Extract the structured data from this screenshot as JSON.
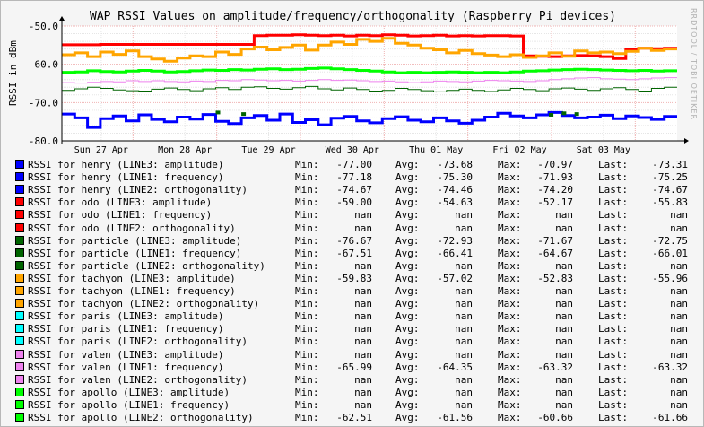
{
  "chart_data": {
    "type": "line",
    "title": "WAP RSSI Values on amplitude/frequency/orthogonality (Raspberry Pi devices)",
    "ylabel": "RSSI in dBm",
    "ylim": [
      -80,
      -50
    ],
    "yticks": [
      "-50.0",
      "-60.0",
      "-70.0",
      "-80.0"
    ],
    "ytick_values": [
      -50,
      -60,
      -70,
      -80
    ],
    "xticks": [
      "Sun 27 Apr",
      "Mon 28 Apr",
      "Tue 29 Apr",
      "Wed 30 Apr",
      "Thu 01 May",
      "Fri 02 May",
      "Sat 03 May"
    ],
    "grid": true,
    "watermark": "RRDTOOL / TOBI OETIKER",
    "plotted_series": [
      {
        "name": "RSSI for henry (LINE3: amplitude)",
        "color": "#0000ff",
        "width": 3,
        "values": [
          -73.0,
          -74.0,
          -76.5,
          -74.2,
          -73.5,
          -74.8,
          -73.2,
          -74.4,
          -75.0,
          -73.8,
          -74.3,
          -73.1,
          -74.9,
          -75.5,
          -74.0,
          -73.4,
          -74.6,
          -73.0,
          -75.2,
          -74.5,
          -75.8,
          -74.1,
          -73.6,
          -74.8,
          -75.3,
          -74.2,
          -73.7,
          -74.6,
          -75.0,
          -74.0,
          -74.8,
          -75.4,
          -74.6,
          -73.8,
          -72.8,
          -73.5,
          -74.0,
          -73.2,
          -72.6,
          -73.4,
          -74.0,
          -73.8,
          -73.3,
          -74.2,
          -73.5,
          -73.9,
          -74.4,
          -73.6
        ]
      },
      {
        "name": "RSSI for odo (LINE3: amplitude)",
        "color": "#ff0000",
        "width": 3,
        "values": [
          -54.9,
          -54.9,
          -54.9,
          -54.8,
          -54.8,
          -54.8,
          -54.8,
          -54.8,
          -54.8,
          -54.8,
          -54.8,
          -54.8,
          -54.8,
          -54.8,
          -54.8,
          -52.5,
          -52.4,
          -52.4,
          -52.3,
          -52.4,
          -52.5,
          -52.4,
          -52.6,
          -52.4,
          -52.5,
          -52.3,
          -52.4,
          -52.6,
          -52.5,
          -52.4,
          -52.6,
          -52.5,
          -52.6,
          -52.5,
          -52.5,
          -52.6,
          -57.8,
          -57.9,
          -58.0,
          -57.8,
          -57.7,
          -57.8,
          -58.0,
          -58.5,
          -56.0,
          -55.8,
          -55.9,
          -55.8
        ]
      },
      {
        "name": "RSSI for tachyon (LINE3: amplitude)",
        "color": "#ffa500",
        "width": 3,
        "values": [
          -57.5,
          -57.0,
          -58.0,
          -56.8,
          -57.4,
          -56.5,
          -58.0,
          -58.6,
          -59.2,
          -58.4,
          -57.8,
          -58.0,
          -56.8,
          -57.4,
          -56.0,
          -55.5,
          -56.2,
          -55.6,
          -55.0,
          -56.3,
          -55.0,
          -54.2,
          -54.8,
          -53.5,
          -54.0,
          -53.2,
          -54.5,
          -55.0,
          -55.8,
          -56.2,
          -57.0,
          -56.4,
          -57.2,
          -57.6,
          -58.0,
          -57.5,
          -58.2,
          -57.8,
          -57.0,
          -57.9,
          -56.5,
          -57.0,
          -56.8,
          -57.2,
          -56.6,
          -55.8,
          -56.4,
          -56.0
        ]
      },
      {
        "name": "RSSI for apollo (LINE2: orthogonality)",
        "color": "#00ff00",
        "width": 3,
        "values": [
          -62.1,
          -62.0,
          -61.7,
          -61.9,
          -62.0,
          -61.8,
          -61.6,
          -61.8,
          -62.0,
          -61.9,
          -61.7,
          -61.5,
          -61.6,
          -61.4,
          -61.5,
          -61.3,
          -61.2,
          -61.4,
          -61.3,
          -61.1,
          -61.0,
          -61.2,
          -61.4,
          -61.6,
          -61.8,
          -62.0,
          -62.2,
          -62.1,
          -62.2,
          -62.1,
          -62.0,
          -62.1,
          -62.2,
          -62.1,
          -62.2,
          -62.0,
          -61.8,
          -61.7,
          -61.5,
          -61.4,
          -61.3,
          -61.4,
          -61.5,
          -61.6,
          -61.7,
          -61.6,
          -61.8,
          -61.7
        ]
      },
      {
        "name": "RSSI for valen (LINE1: frequency)",
        "color": "#ee82ee",
        "width": 1,
        "values": [
          -64.8,
          -64.9,
          -64.7,
          -64.5,
          -64.6,
          -64.3,
          -64.5,
          -64.3,
          -64.5,
          -64.6,
          -64.4,
          -64.5,
          -64.2,
          -64.3,
          -64.0,
          -64.1,
          -64.3,
          -64.2,
          -64.4,
          -64.2,
          -64.0,
          -64.2,
          -64.1,
          -64.3,
          -64.5,
          -64.4,
          -64.6,
          -64.8,
          -64.6,
          -64.4,
          -64.5,
          -64.6,
          -64.4,
          -64.2,
          -64.3,
          -64.4,
          -64.5,
          -64.3,
          -64.0,
          -63.8,
          -63.6,
          -63.5,
          -63.8,
          -63.9,
          -64.0,
          -63.8,
          -63.6,
          -63.5
        ]
      },
      {
        "name": "RSSI for particle (LINE1: frequency)",
        "color": "#006400",
        "width": 1,
        "values": [
          -66.8,
          -66.4,
          -66.0,
          -66.3,
          -66.7,
          -66.9,
          -67.0,
          -66.5,
          -66.2,
          -66.6,
          -66.9,
          -66.4,
          -66.1,
          -66.6,
          -66.0,
          -65.9,
          -66.3,
          -66.5,
          -66.1,
          -65.8,
          -66.4,
          -66.7,
          -66.2,
          -66.6,
          -67.0,
          -66.8,
          -66.3,
          -66.6,
          -66.9,
          -67.2,
          -66.8,
          -66.5,
          -66.8,
          -67.1,
          -66.7,
          -66.3,
          -66.6,
          -66.9,
          -66.4,
          -66.2,
          -66.5,
          -66.8,
          -66.4,
          -66.1,
          -66.6,
          -67.0,
          -66.3,
          -66.0
        ]
      }
    ],
    "particle_amplitude_points": [
      {
        "i": 12,
        "y": -72.6
      },
      {
        "i": 14,
        "y": -73.0
      },
      {
        "i": 38,
        "y": -73.2
      },
      {
        "i": 39,
        "y": -72.8
      },
      {
        "i": 40,
        "y": -73.0
      }
    ]
  },
  "legend": {
    "min_label": "Min:",
    "avg_label": "Avg:",
    "max_label": "Max:",
    "last_label": "Last:",
    "rows": [
      {
        "color": "#0000ff",
        "name": "RSSI for henry (LINE3: amplitude)",
        "min": "-77.00",
        "avg": "-73.68",
        "max": "-70.97",
        "last": "-73.31"
      },
      {
        "color": "#0000ff",
        "name": "RSSI for henry (LINE1: frequency)",
        "min": "-77.18",
        "avg": "-75.30",
        "max": "-71.93",
        "last": "-75.25"
      },
      {
        "color": "#0000ff",
        "name": "RSSI for henry (LINE2: orthogonality)",
        "min": "-74.67",
        "avg": "-74.46",
        "max": "-74.20",
        "last": "-74.67"
      },
      {
        "color": "#ff0000",
        "name": "RSSI for odo (LINE3: amplitude)",
        "min": "-59.00",
        "avg": "-54.63",
        "max": "-52.17",
        "last": "-55.83"
      },
      {
        "color": "#ff0000",
        "name": "RSSI for odo (LINE1: frequency)",
        "min": "nan",
        "avg": "nan",
        "max": "nan",
        "last": "nan"
      },
      {
        "color": "#ff0000",
        "name": "RSSI for odo (LINE2: orthogonality)",
        "min": "nan",
        "avg": "nan",
        "max": "nan",
        "last": "nan"
      },
      {
        "color": "#006400",
        "name": "RSSI for particle (LINE3: amplitude)",
        "min": "-76.67",
        "avg": "-72.93",
        "max": "-71.67",
        "last": "-72.75"
      },
      {
        "color": "#006400",
        "name": "RSSI for particle (LINE1: frequency)",
        "min": "-67.51",
        "avg": "-66.41",
        "max": "-64.67",
        "last": "-66.01"
      },
      {
        "color": "#006400",
        "name": "RSSI for particle (LINE2: orthogonality)",
        "min": "nan",
        "avg": "nan",
        "max": "nan",
        "last": "nan"
      },
      {
        "color": "#ffa500",
        "name": "RSSI for tachyon (LINE3: amplitude)",
        "min": "-59.83",
        "avg": "-57.02",
        "max": "-52.83",
        "last": "-55.96"
      },
      {
        "color": "#ffa500",
        "name": "RSSI for tachyon (LINE1: frequency)",
        "min": "nan",
        "avg": "nan",
        "max": "nan",
        "last": "nan"
      },
      {
        "color": "#ffa500",
        "name": "RSSI for tachyon (LINE2: orthogonality)",
        "min": "nan",
        "avg": "nan",
        "max": "nan",
        "last": "nan"
      },
      {
        "color": "#00ffff",
        "name": "RSSI for paris (LINE3: amplitude)",
        "min": "nan",
        "avg": "nan",
        "max": "nan",
        "last": "nan"
      },
      {
        "color": "#00ffff",
        "name": "RSSI for paris (LINE1: frequency)",
        "min": "nan",
        "avg": "nan",
        "max": "nan",
        "last": "nan"
      },
      {
        "color": "#00ffff",
        "name": "RSSI for paris (LINE2: orthogonality)",
        "min": "nan",
        "avg": "nan",
        "max": "nan",
        "last": "nan"
      },
      {
        "color": "#ee82ee",
        "name": "RSSI for valen (LINE3: amplitude)",
        "min": "nan",
        "avg": "nan",
        "max": "nan",
        "last": "nan"
      },
      {
        "color": "#ee82ee",
        "name": "RSSI for valen (LINE1: frequency)",
        "min": "-65.99",
        "avg": "-64.35",
        "max": "-63.32",
        "last": "-63.32"
      },
      {
        "color": "#ee82ee",
        "name": "RSSI for valen (LINE2: orthogonality)",
        "min": "nan",
        "avg": "nan",
        "max": "nan",
        "last": "nan"
      },
      {
        "color": "#00ff00",
        "name": "RSSI for apollo (LINE3: amplitude)",
        "min": "nan",
        "avg": "nan",
        "max": "nan",
        "last": "nan"
      },
      {
        "color": "#00ff00",
        "name": "RSSI for apollo (LINE1: frequency)",
        "min": "nan",
        "avg": "nan",
        "max": "nan",
        "last": "nan"
      },
      {
        "color": "#00ff00",
        "name": "RSSI for apollo (LINE2: orthogonality)",
        "min": "-62.51",
        "avg": "-61.56",
        "max": "-60.66",
        "last": "-61.66"
      }
    ]
  }
}
